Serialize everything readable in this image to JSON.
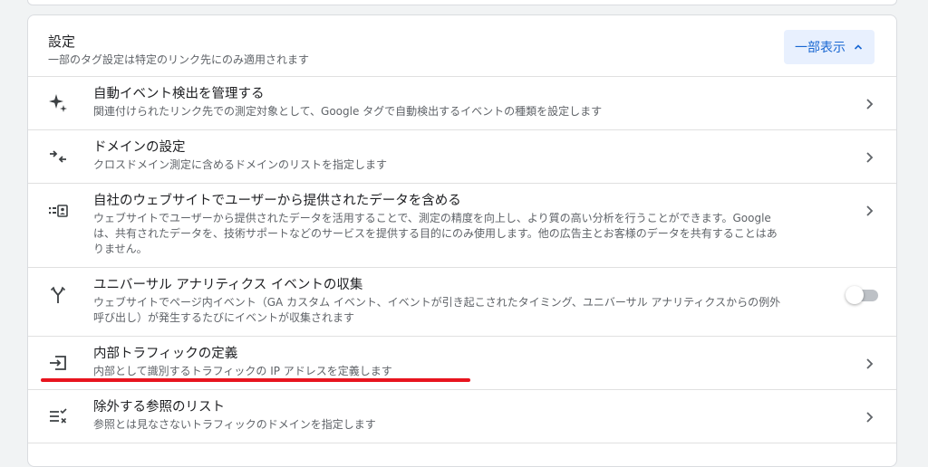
{
  "header": {
    "title": "設定",
    "subtitle": "一部のタグ設定は特定のリンク先にのみ適用されます",
    "show_less_label": "一部表示"
  },
  "rows": [
    {
      "icon": "sparkle-icon",
      "title": "自動イベント検出を管理する",
      "desc_lines": [
        "関連付けられたリンク先での測定対象として、Google タグで自動検出するイベントの種類を設定します"
      ],
      "control": "chevron"
    },
    {
      "icon": "merge-arrows-icon",
      "title": "ドメインの設定",
      "desc_lines": [
        "クロスドメイン測定に含めるドメインのリストを指定します"
      ],
      "control": "chevron"
    },
    {
      "icon": "user-data-icon",
      "title": "自社のウェブサイトでユーザーから提供されたデータを含める",
      "desc_lines": [
        "ウェブサイトでユーザーから提供されたデータを活用することで、測定の精度を向上し、より質の高い分析を行うことができます。Google",
        "は、共有されたデータを、技術サポートなどのサービスを提供する目的にのみ使用します。他の広告主とお客様のデータを共有することはあ",
        "りません。"
      ],
      "control": "chevron"
    },
    {
      "icon": "fork-icon",
      "title": "ユニバーサル アナリティクス イベントの収集",
      "desc_lines": [
        "ウェブサイトでページ内イベント（GA カスタム イベント、イベントが引き起こされたタイミング、ユニバーサル アナリティクスからの例外",
        "呼び出し）が発生するたびにイベントが収集されます"
      ],
      "control": "toggle",
      "toggle_on": false
    },
    {
      "icon": "login-icon",
      "title": "内部トラフィックの定義",
      "desc_lines": [
        "内部として識別するトラフィックの IP アドレスを定義します"
      ],
      "control": "chevron"
    },
    {
      "icon": "exclude-list-icon",
      "title": "除外する参照のリスト",
      "desc_lines": [
        "参照とは見なさないトラフィックのドメインを指定します"
      ],
      "control": "chevron"
    }
  ],
  "colors": {
    "accent": "#1967d2",
    "accent_bg": "#e8f0fe",
    "highlight": "#e8141e",
    "icon": "#3c4043"
  }
}
